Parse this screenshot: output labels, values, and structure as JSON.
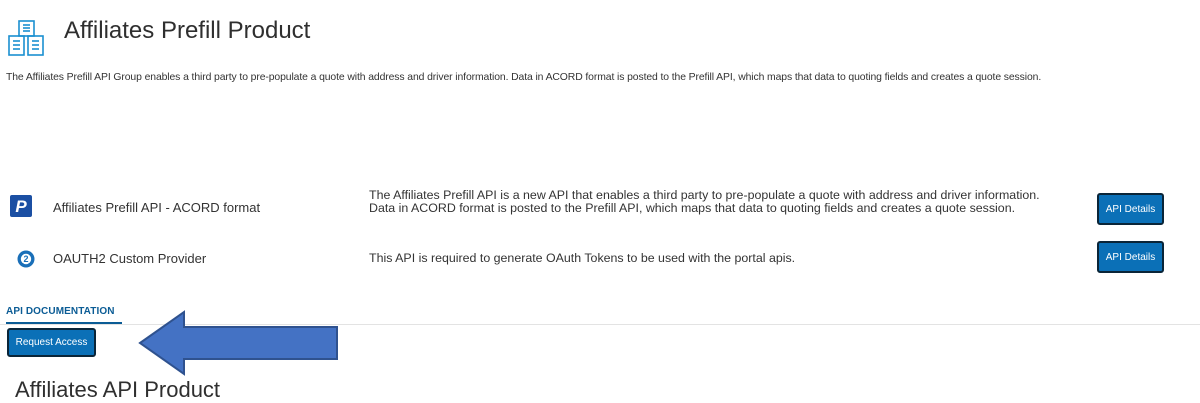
{
  "header": {
    "title": "Affiliates Prefill Product",
    "description": "The Affiliates Prefill API Group enables a third party to pre-populate a quote with address and driver information. Data in ACORD format is posted to the Prefill API, which maps that data to quoting fields and creates a quote session.",
    "icon": "buildings-icon",
    "accent_color": "#1a8fd0"
  },
  "apis": [
    {
      "name": "Affiliates Prefill API - ACORD format",
      "description": "The Affiliates Prefill API is a new API that enables a third party to pre-populate a quote with address and driver information. Data in ACORD format is posted to the Prefill API, which maps that data to quoting fields and creates a quote session.",
      "button_label": "API Details",
      "icon": "progressive-p-logo-icon"
    },
    {
      "name": "OAUTH2 Custom Provider",
      "description": "This API is required to generate OAuth Tokens to be used with the portal apis.",
      "button_label": "API Details",
      "icon": "oauth2-icon"
    }
  ],
  "tabs": [
    {
      "label": "API DOCUMENTATION",
      "active": true
    }
  ],
  "request_access_label": "Request Access",
  "annotation": {
    "icon": "left-arrow-icon",
    "color": "#4472c4"
  },
  "section": {
    "title": "Affiliates API Product"
  },
  "colors": {
    "button_bg": "#0b70b7",
    "tab_active": "#0b5c95"
  }
}
